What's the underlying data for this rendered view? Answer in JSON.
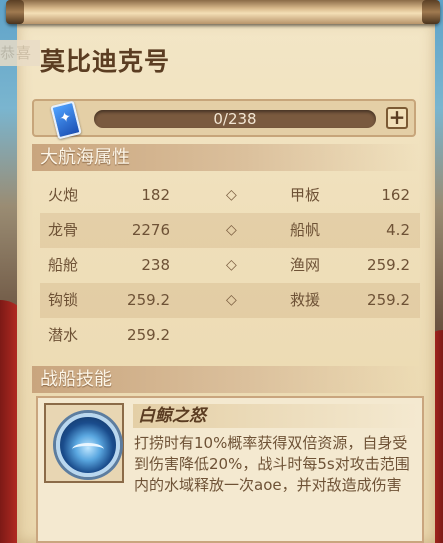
{
  "partial_banner": "恭喜",
  "ship_name": "莫比迪克号",
  "progress": {
    "current": 0,
    "max": 238,
    "text": "0/238",
    "plus": "+"
  },
  "sections": {
    "attributes": "大航海属性",
    "skills": "战船技能"
  },
  "attributes": [
    {
      "left_name": "火炮",
      "left_value": "182",
      "sep": "◇",
      "right_name": "甲板",
      "right_value": "162"
    },
    {
      "left_name": "龙骨",
      "left_value": "2276",
      "sep": "◇",
      "right_name": "船帆",
      "right_value": "4.2"
    },
    {
      "left_name": "船舱",
      "left_value": "238",
      "sep": "◇",
      "right_name": "渔网",
      "right_value": "259.2"
    },
    {
      "left_name": "钩锁",
      "left_value": "259.2",
      "sep": "◇",
      "right_name": "救援",
      "right_value": "259.2"
    },
    {
      "left_name": "潜水",
      "left_value": "259.2"
    }
  ],
  "skill": {
    "name": "白鲸之怒",
    "description": "打捞时有10%概率获得双倍资源，自身受到伤害降低20%，战斗时每5s对攻击范围内的水域释放一次aoe，并对敌造成伤害"
  },
  "colors": {
    "paper": "#f3e6c6",
    "header": "#c9a57e",
    "text": "#6e5236",
    "title": "#5b3d22"
  },
  "icons": {
    "card": "blue-card-icon",
    "skill": "whale-wave-icon"
  }
}
